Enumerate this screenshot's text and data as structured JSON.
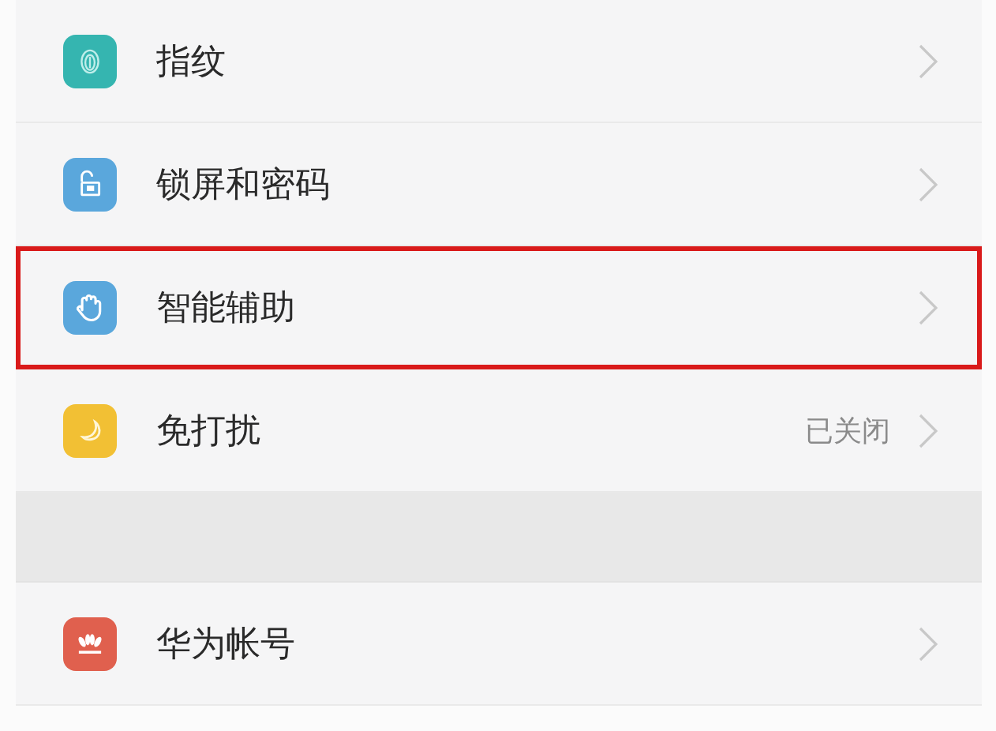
{
  "sections": [
    {
      "items": [
        {
          "label": "指纹",
          "color": "#35b5b0",
          "highlighted": false
        },
        {
          "label": "锁屏和密码",
          "color": "#5aa7dc",
          "highlighted": false
        },
        {
          "label": "智能辅助",
          "color": "#5aa7dc",
          "highlighted": true
        },
        {
          "label": "免打扰",
          "color": "#f2c034",
          "value": "已关闭",
          "highlighted": false
        }
      ]
    },
    {
      "items": [
        {
          "label": "华为帐号",
          "color": "#e0604e",
          "highlighted": false
        }
      ]
    }
  ]
}
